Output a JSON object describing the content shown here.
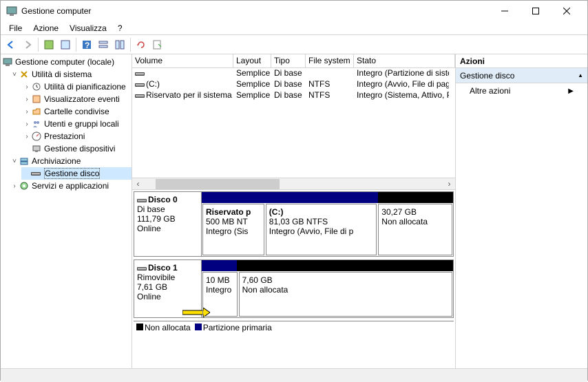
{
  "window": {
    "title": "Gestione computer"
  },
  "menu": {
    "file": "File",
    "action": "Azione",
    "view": "Visualizza",
    "help": "?"
  },
  "tree": {
    "root": "Gestione computer (locale)",
    "sys_tools": "Utilità di sistema",
    "scheduler": "Utilità di pianificazione",
    "eventviewer": "Visualizzatore eventi",
    "shared": "Cartelle condivise",
    "users": "Utenti e gruppi locali",
    "perf": "Prestazioni",
    "devmgr": "Gestione dispositivi",
    "storage": "Archiviazione",
    "diskmgmt": "Gestione disco",
    "services": "Servizi e applicazioni"
  },
  "columns": {
    "volume": "Volume",
    "layout": "Layout",
    "type": "Tipo",
    "fs": "File system",
    "state": "Stato"
  },
  "volumes": [
    {
      "name": "",
      "layout": "Semplice",
      "type": "Di base",
      "fs": "",
      "state": "Integro (Partizione di siste"
    },
    {
      "name": "(C:)",
      "layout": "Semplice",
      "type": "Di base",
      "fs": "NTFS",
      "state": "Integro (Avvio, File di pag"
    },
    {
      "name": "Riservato per il sistema",
      "layout": "Semplice",
      "type": "Di base",
      "fs": "NTFS",
      "state": "Integro (Sistema, Attivo, P"
    }
  ],
  "disks": {
    "d0": {
      "name": "Disco 0",
      "type": "Di base",
      "size": "111,79 GB",
      "status": "Online",
      "parts": [
        {
          "name": "Riservato p",
          "size": "500 MB NT",
          "state": "Integro (Sis"
        },
        {
          "name": "(C:)",
          "size": "81,03 GB NTFS",
          "state": "Integro (Avvio, File di p"
        },
        {
          "name": "",
          "size": "30,27 GB",
          "state": "Non allocata"
        }
      ]
    },
    "d1": {
      "name": "Disco 1",
      "type": "Rimovibile",
      "size": "7,61 GB",
      "status": "Online",
      "parts": [
        {
          "name": "",
          "size": "10 MB",
          "state": "Integro"
        },
        {
          "name": "",
          "size": "7,60 GB",
          "state": "Non allocata"
        }
      ]
    }
  },
  "legend": {
    "unalloc": "Non allocata",
    "primary": "Partizione primaria"
  },
  "actions": {
    "header": "Azioni",
    "group": "Gestione disco",
    "more": "Altre azioni"
  },
  "colors": {
    "primary": "#000080",
    "unalloc": "#000000",
    "accent": "#e0ecf7"
  }
}
